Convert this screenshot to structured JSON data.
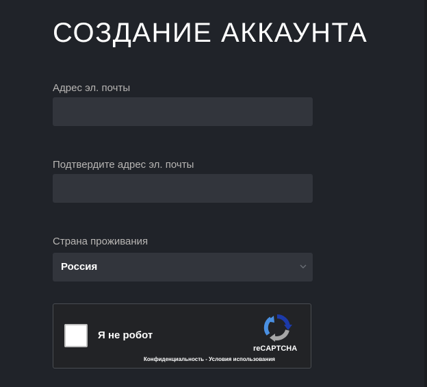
{
  "form": {
    "title": "СОЗДАНИЕ АККАУНТА",
    "email": {
      "label": "Адрес эл. почты",
      "value": ""
    },
    "email_confirm": {
      "label": "Подтвердите адрес эл. почты",
      "value": ""
    },
    "country": {
      "label": "Страна проживания",
      "selected": "Россия"
    },
    "captcha": {
      "checkbox_label": "Я не робот",
      "checked": false,
      "brand": "reCAPTCHA",
      "privacy_link": "Конфиденциальность",
      "separator": " - ",
      "terms_link": "Условия использования"
    }
  },
  "colors": {
    "background": "#202329",
    "input_background": "#32353c",
    "label_text": "#b8b6b4",
    "title_text": "#ffffff"
  },
  "icons": {
    "select_arrow": "chevron-down-icon",
    "captcha_logo": "recaptcha-logo-icon"
  }
}
